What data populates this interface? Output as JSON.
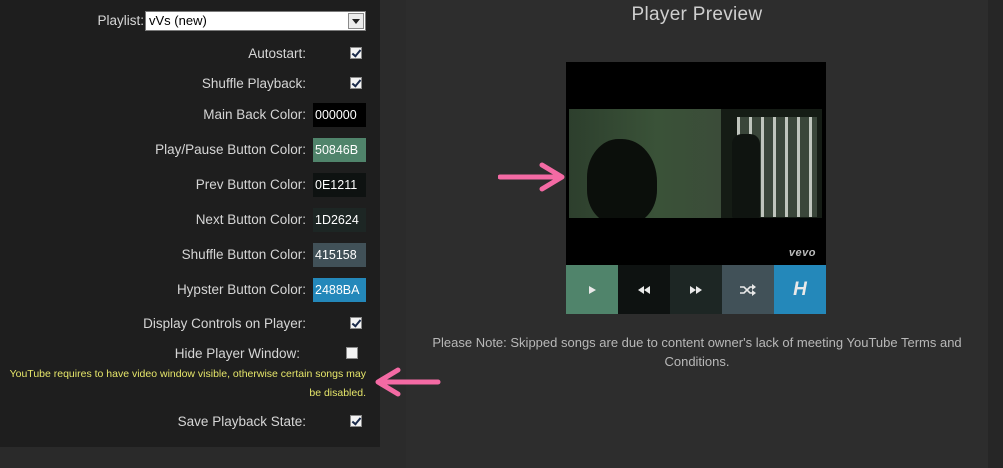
{
  "settings": {
    "playlist_label": "Playlist:",
    "playlist_value": "vVs (new)",
    "autostart_label": "Autostart:",
    "shuffle_label": "Shuffle Playback:",
    "main_back_color_label": "Main Back Color:",
    "main_back_color_value": "000000",
    "play_pause_color_label": "Play/Pause Button Color:",
    "play_pause_color_value": "50846B",
    "prev_color_label": "Prev Button Color:",
    "prev_color_value": "0E1211",
    "next_color_label": "Next Button Color:",
    "next_color_value": "1D2624",
    "shuffle_color_label": "Shuffle Button Color:",
    "shuffle_color_value": "415158",
    "hypster_color_label": "Hypster Button Color:",
    "hypster_color_value": "2488BA",
    "display_controls_label": "Display Controls on Player:",
    "hide_player_label": "Hide Player Window:",
    "hide_player_warning": "YouTube requires to have video window visible, otherwise certain songs may be disabled.",
    "save_state_label": "Save Playback State:",
    "autostart_checked": true,
    "shuffle_checked": true,
    "display_controls_checked": true,
    "hide_player_checked": false,
    "save_state_checked": true
  },
  "preview": {
    "title": "Player Preview",
    "vevo": "vevo",
    "hypster_glyph": "H",
    "note": "Please Note: Skipped songs are due to content owner's lack of meeting YouTube Terms and Conditions."
  },
  "colors": {
    "main_back": "#000000",
    "play_pause": "#50846b",
    "prev": "#0e1211",
    "next": "#1d2624",
    "shuffle": "#415158",
    "hypster": "#2488ba",
    "annotation_arrow": "#f46aa4",
    "warning_text": "#e6e66a"
  },
  "icons": {
    "play": "play-icon",
    "prev": "rewind-icon",
    "next": "fast-forward-icon",
    "shuffle": "shuffle-icon"
  }
}
